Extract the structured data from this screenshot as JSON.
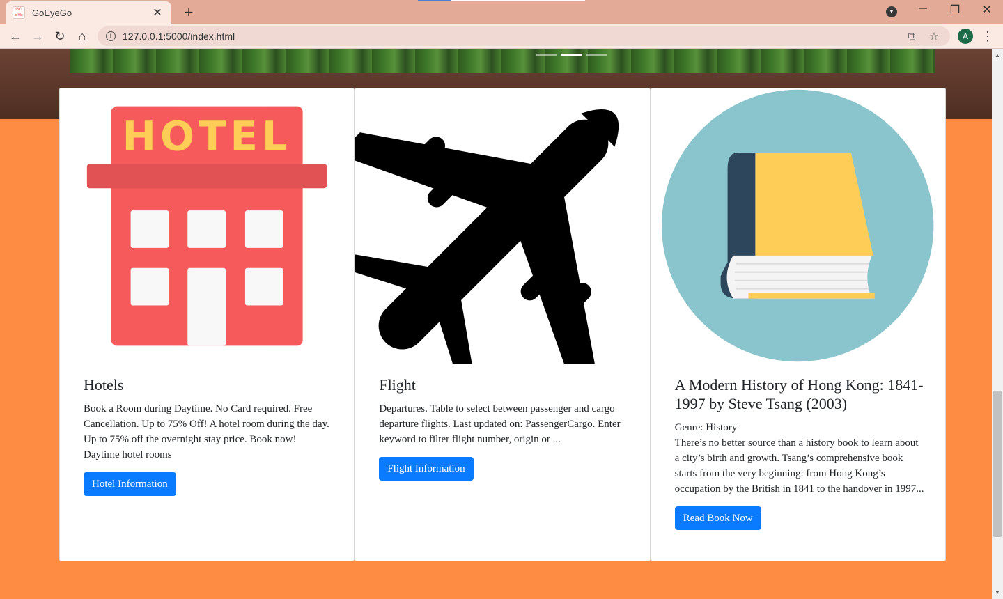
{
  "browser": {
    "tab_title": "GoEyeGo",
    "favicon_text": "GO EYE GO",
    "url": "127.0.0.1:5000/index.html",
    "avatar_letter": "A"
  },
  "cards": [
    {
      "title": "Hotels",
      "hotel_sign": "HOTEL",
      "text": "Book a Room during Daytime. No Card required. Free Cancellation. Up to 75% Off! A hotel room during the day. Up to 75% off the overnight stay price. Book now! Daytime hotel rooms",
      "button": "Hotel Information"
    },
    {
      "title": "Flight",
      "text": "Departures. Table to select between passenger and cargo departure flights. Last updated on: PassengerCargo. Enter keyword to filter flight number, origin or ...",
      "button": "Flight Information"
    },
    {
      "title": "A Modern History of Hong Kong: 1841-1997 by Steve Tsang (2003)",
      "genre": "Genre: History",
      "text": "There’s no better source than a history book to learn about a city’s birth and growth. Tsang’s comprehensive book starts from the very beginning: from Hong Kong’s occupation by the British in 1841 to the handover in 1997...",
      "button": "Read Book Now"
    }
  ],
  "colors": {
    "page_bg": "#ff8c42",
    "button": "#0a7bff",
    "hotel_red": "#f65a5b",
    "book_circle": "#8ac5cd",
    "book_yellow": "#fecd57"
  }
}
